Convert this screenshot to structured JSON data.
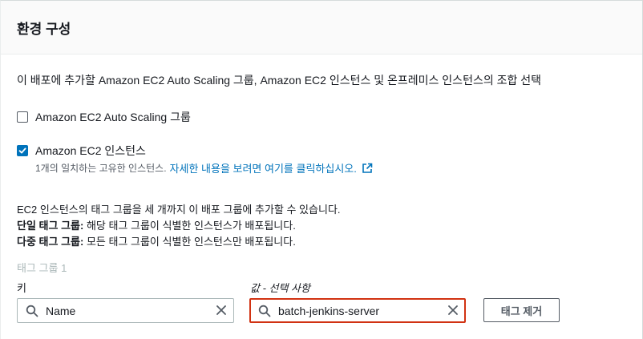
{
  "panel": {
    "title": "환경 구성",
    "description": "이 배포에 추가할 Amazon EC2 Auto Scaling 그룹, Amazon EC2 인스턴스 및 온프레미스 인스턴스의 조합 선택"
  },
  "options": {
    "asg": {
      "label": "Amazon EC2 Auto Scaling 그룹",
      "checked": false
    },
    "ec2": {
      "label": "Amazon EC2 인스턴스",
      "checked": true,
      "note": "1개의 일치하는 고유한 인스턴스.",
      "link": "자세한 내용을 보려면 여기를 클릭하십시오."
    }
  },
  "info": {
    "line1": "EC2 인스턴스의 태그 그룹을 세 개까지 이 배포 그룹에 추가할 수 있습니다.",
    "single_label": "단일 태그 그룹:",
    "single_text": " 해당 태그 그룹이 식별한 인스턴스가 배포됩니다.",
    "multi_label": "다중 태그 그룹:",
    "multi_text": " 모든 태그 그룹이 식별한 인스턴스만 배포됩니다."
  },
  "tag_group": {
    "label": "태그 그룹 1",
    "key_label": "키",
    "value_label": "값 - 선택 사항",
    "key_value": "Name",
    "value_value": "batch-jenkins-server",
    "remove_label": "태그 제거"
  },
  "icons": {
    "checkbox_checked": "check-icon",
    "external_link": "external-link-icon",
    "search": "search-icon",
    "clear": "close-icon"
  },
  "colors": {
    "link": "#0073bb",
    "checkbox": "#0073bb",
    "focus_border": "#d13212"
  }
}
